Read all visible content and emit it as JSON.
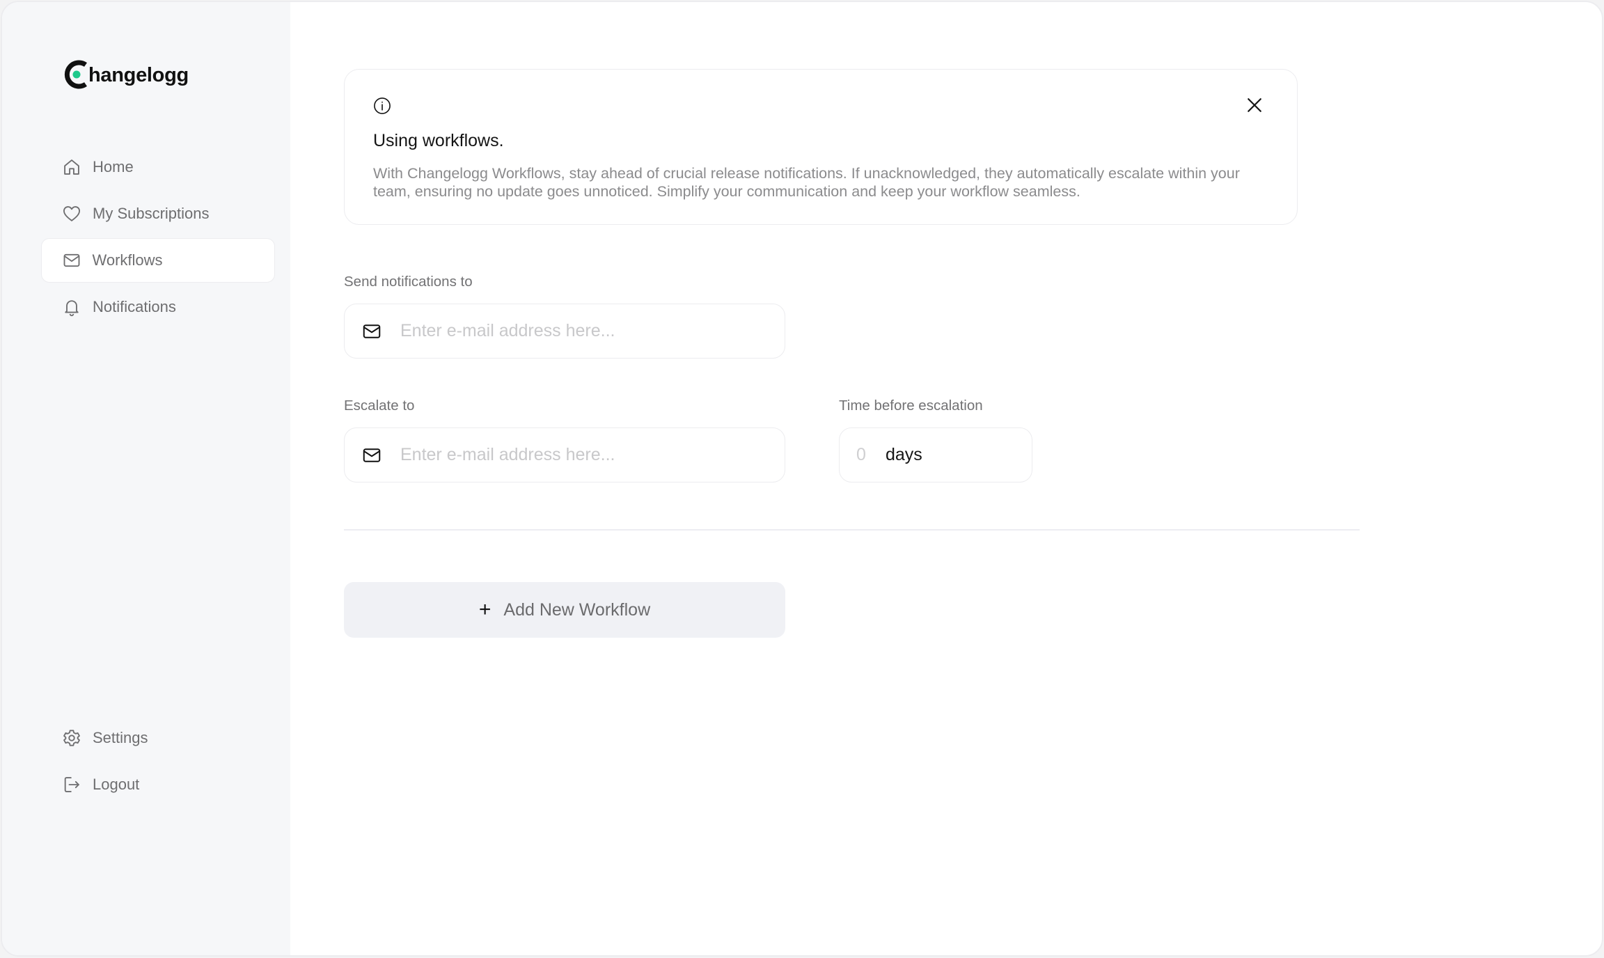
{
  "app": {
    "brand_name": "hangelogg",
    "brand_full": "Changelogg",
    "accent_color": "#1ec98b"
  },
  "sidebar": {
    "items": [
      {
        "label": "Home",
        "icon": "home-icon",
        "active": false
      },
      {
        "label": "My Subscriptions",
        "icon": "heart-icon",
        "active": false
      },
      {
        "label": "Workflows",
        "icon": "mail-icon",
        "active": true
      },
      {
        "label": "Notifications",
        "icon": "bell-icon",
        "active": false
      }
    ],
    "bottom_items": [
      {
        "label": "Settings",
        "icon": "gear-icon"
      },
      {
        "label": "Logout",
        "icon": "logout-icon"
      }
    ]
  },
  "info_card": {
    "icon": "info-icon",
    "title": "Using workflows.",
    "body": "With Changelogg Workflows, stay ahead of crucial release notifications. If unacknowledged, they automatically escalate within your team, ensuring no update goes unnoticed. Simplify your communication and keep your workflow seamless.",
    "close_icon": "close-icon"
  },
  "form": {
    "send_to": {
      "label": "Send notifications to",
      "placeholder": "Enter e-mail address here...",
      "value": ""
    },
    "escalate_to": {
      "label": "Escalate to",
      "placeholder": "Enter e-mail address here...",
      "value": ""
    },
    "time_before_escalation": {
      "label": "Time before escalation",
      "value": "0",
      "unit": "days"
    }
  },
  "actions": {
    "add_workflow_label": "Add New Workflow",
    "add_icon": "+"
  }
}
